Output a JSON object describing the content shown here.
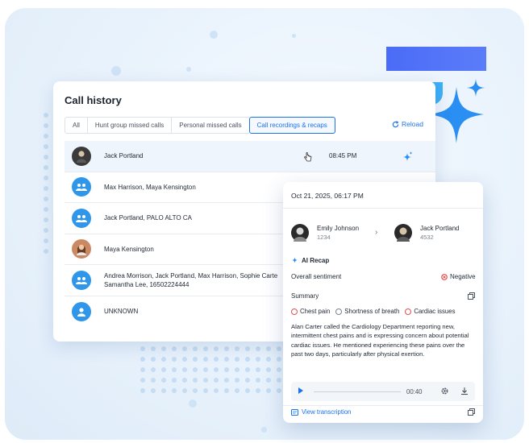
{
  "colors": {
    "accent": "#1a73e8",
    "avatar_blue": "#2f96ea",
    "negative": "#e05252",
    "sparkle": "#2a8ff2"
  },
  "panel": {
    "title": "Call history",
    "tabs": [
      {
        "label": "All"
      },
      {
        "label": "Hunt group missed calls"
      },
      {
        "label": "Personal missed calls"
      },
      {
        "label": "Call recordings & recaps",
        "active": true
      }
    ],
    "reload_label": "Reload"
  },
  "rows": [
    {
      "name": "Jack Portland",
      "time": "08:45 PM",
      "avatar": "photo",
      "selected": true
    },
    {
      "name": "Max Harrison, Maya Kensington",
      "avatar": "group-icon"
    },
    {
      "name": "Jack Portland, PALO ALTO CA",
      "avatar": "group-icon"
    },
    {
      "name": "Maya Kensington",
      "avatar": "photo"
    },
    {
      "name_line1": "Andrea Morrison, Jack Portland, Max Harrison, Sophie Carte",
      "name_line2": "Samantha Lee, 16502224444",
      "avatar": "group-icon"
    },
    {
      "name": "UNKNOWN",
      "avatar": "person-icon"
    }
  ],
  "recap": {
    "date": "Oct 21, 2025, 06:17 PM",
    "caller": {
      "name": "Emily Johnson",
      "ext": "1234"
    },
    "callee": {
      "name": "Jack Portland",
      "ext": "4532"
    },
    "ai_recap_label": "AI Recap",
    "sentiment_label": "Overall sentiment",
    "sentiment_value": "Negative",
    "summary_label": "Summary",
    "chips": [
      "Chest pain",
      "Shortness of breath",
      "Cardiac issues"
    ],
    "summary_text": "Alan Carter called the Cardiology Department reporting new, intermittent chest pains and is expressing concern about potential cardiac issues. He mentioned experiencing these pains over the past two days, particularly after physical exertion.",
    "player_time": "00:40",
    "view_transcription": "View transcription"
  }
}
